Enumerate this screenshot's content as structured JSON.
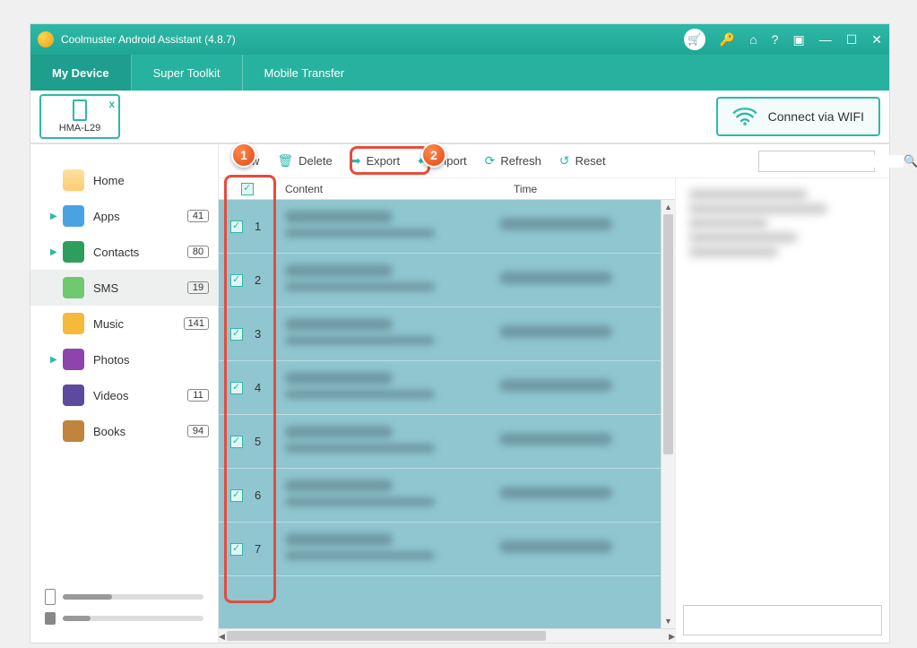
{
  "app": {
    "title": "Coolmuster Android Assistant (4.8.7)"
  },
  "tabs": {
    "device": "My Device",
    "toolkit": "Super Toolkit",
    "transfer": "Mobile Transfer"
  },
  "device": {
    "name": "HMA-L29",
    "close": "x"
  },
  "wifi": {
    "label": "Connect via WIFI"
  },
  "sidebar": {
    "items": [
      {
        "label": "Home",
        "icon": "ic-home",
        "expandable": false
      },
      {
        "label": "Apps",
        "icon": "ic-apps",
        "badge": "41",
        "expandable": true
      },
      {
        "label": "Contacts",
        "icon": "ic-contacts",
        "badge": "80",
        "expandable": true
      },
      {
        "label": "SMS",
        "icon": "ic-sms",
        "badge": "19",
        "selected": true
      },
      {
        "label": "Music",
        "icon": "ic-music",
        "badge": "141"
      },
      {
        "label": "Photos",
        "icon": "ic-photos",
        "expandable": true
      },
      {
        "label": "Videos",
        "icon": "ic-videos",
        "badge": "11"
      },
      {
        "label": "Books",
        "icon": "ic-books",
        "badge": "94"
      }
    ]
  },
  "toolbar": {
    "new": "w",
    "delete": "Delete",
    "export": "Export",
    "import": "Import",
    "refresh": "Refresh",
    "reset": "Reset"
  },
  "columns": {
    "content": "Content",
    "time": "Time"
  },
  "rows": [
    {
      "n": "1"
    },
    {
      "n": "2"
    },
    {
      "n": "3"
    },
    {
      "n": "4"
    },
    {
      "n": "5"
    },
    {
      "n": "6"
    },
    {
      "n": "7"
    }
  ],
  "callouts": {
    "one": "1",
    "two": "2"
  },
  "search": {
    "placeholder": ""
  },
  "storage": {
    "phone_pct": 35,
    "sd_pct": 20
  }
}
